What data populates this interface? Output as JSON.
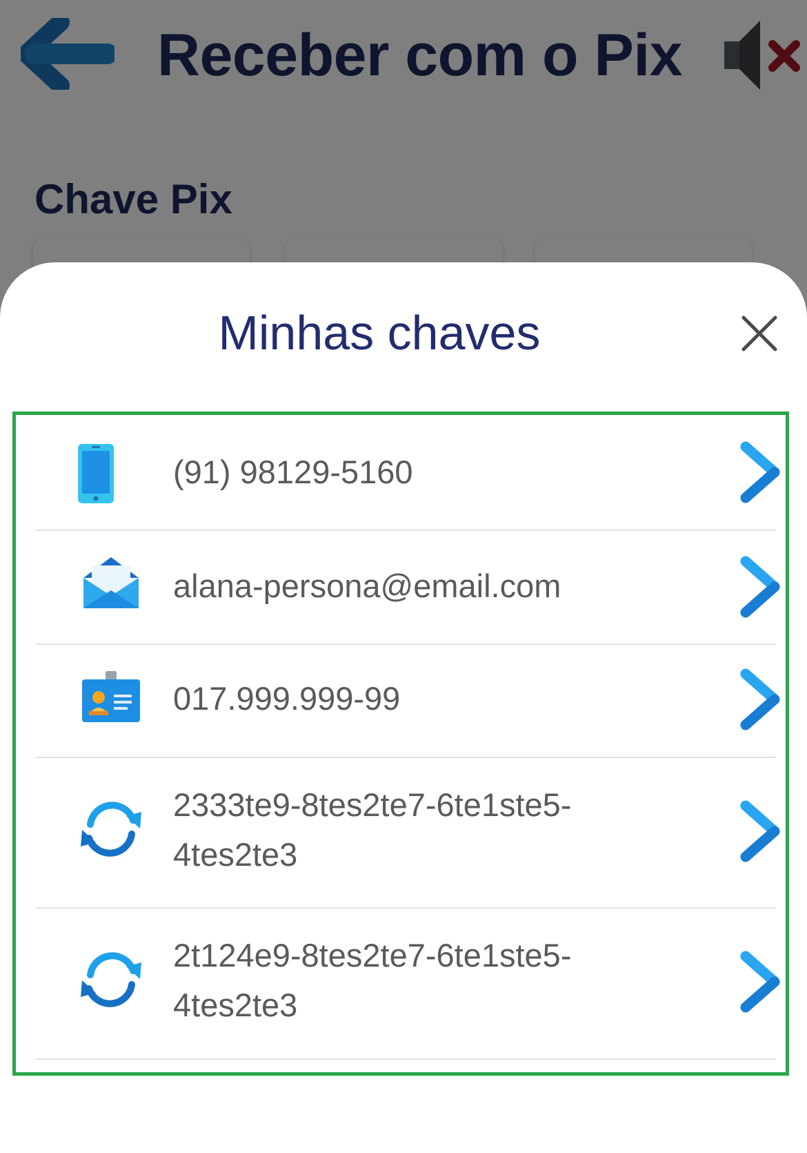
{
  "header": {
    "title": "Receber com o Pix",
    "back_icon": "arrow-left-icon",
    "sound_icon": "sound-muted-icon"
  },
  "section": {
    "title": "Chave Pix"
  },
  "sheet": {
    "title": "Minhas chaves",
    "close_icon": "close-icon"
  },
  "keys": [
    {
      "type": "phone",
      "icon": "smartphone-icon",
      "value": "(91) 98129-5160"
    },
    {
      "type": "email",
      "icon": "envelope-icon",
      "value": "alana-persona@email.com"
    },
    {
      "type": "cpf",
      "icon": "id-card-icon",
      "value": "017.999.999-99"
    },
    {
      "type": "random",
      "icon": "sync-icon",
      "value": "2333te9-8tes2te7-6te1ste5-\n4tes2te3"
    },
    {
      "type": "random",
      "icon": "sync-icon",
      "value": "2t124e9-8tes2te7-6te1ste5-\n4tes2te3"
    }
  ],
  "colors": {
    "title_navy": "#1f2a5c",
    "accent_blue": "#1e96e8",
    "frame_green": "#28a846",
    "muted_red": "#c0182a"
  }
}
